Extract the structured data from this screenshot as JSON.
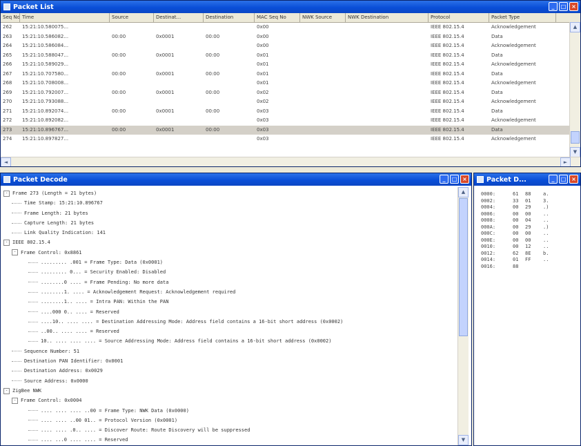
{
  "packet_list": {
    "title": "Packet List",
    "columns": [
      "Seq No",
      "Time",
      "Source",
      "Destinat...",
      "Destination",
      "MAC Seq No",
      "NWK Source",
      "NWK Destination",
      "Protocol",
      "Packet Type"
    ],
    "rows": [
      [
        "262",
        "15:21:10.580075...",
        "",
        "",
        "",
        "0x00",
        "",
        "",
        "IEEE 802.15.4",
        "Acknowledgement"
      ],
      [
        "263",
        "15:21:10.586082...",
        "00:00",
        "0x0001",
        "00:00",
        "0x00",
        "",
        "",
        "IEEE 802.15.4",
        "Data"
      ],
      [
        "264",
        "15:21:10.586084...",
        "",
        "",
        "",
        "0x00",
        "",
        "",
        "IEEE 802.15.4",
        "Acknowledgement"
      ],
      [
        "265",
        "15:21:10.588047...",
        "00:00",
        "0x0001",
        "00:00",
        "0x01",
        "",
        "",
        "IEEE 802.15.4",
        "Data"
      ],
      [
        "266",
        "15:21:10.589029...",
        "",
        "",
        "",
        "0x01",
        "",
        "",
        "IEEE 802.15.4",
        "Acknowledgement"
      ],
      [
        "267",
        "15:21:10.707580...",
        "00:00",
        "0x0001",
        "00:00",
        "0x01",
        "",
        "",
        "IEEE 802.15.4",
        "Data"
      ],
      [
        "268",
        "15:21:10.708008...",
        "",
        "",
        "",
        "0x01",
        "",
        "",
        "IEEE 802.15.4",
        "Acknowledgement"
      ],
      [
        "269",
        "15:21:10.792007...",
        "00:00",
        "0x0001",
        "00:00",
        "0x02",
        "",
        "",
        "IEEE 802.15.4",
        "Data"
      ],
      [
        "270",
        "15:21:10.793088...",
        "",
        "",
        "",
        "0x02",
        "",
        "",
        "IEEE 802.15.4",
        "Acknowledgement"
      ],
      [
        "271",
        "15:21:10.892074...",
        "00:00",
        "0x0001",
        "00:00",
        "0x03",
        "",
        "",
        "IEEE 802.15.4",
        "Data"
      ],
      [
        "272",
        "15:21:10.892082...",
        "",
        "",
        "",
        "0x03",
        "",
        "",
        "IEEE 802.15.4",
        "Acknowledgement"
      ],
      [
        "273",
        "15:21:10.896767...",
        "00:00",
        "0x0001",
        "00:00",
        "0x03",
        "",
        "",
        "IEEE 802.15.4",
        "Data"
      ],
      [
        "274",
        "15:21:10.897827...",
        "",
        "",
        "",
        "0x03",
        "",
        "",
        "IEEE 802.15.4",
        "Acknowledgement"
      ]
    ],
    "selected_row": 11
  },
  "packet_decode": {
    "title": "Packet Decode",
    "lines": [
      {
        "toggle": "-",
        "text": "Frame 273 (Length = 21 bytes)"
      },
      {
        "toggle": "",
        "text": "Time Stamp: 15:21:10.896767"
      },
      {
        "toggle": "",
        "text": "Frame Length: 21 bytes"
      },
      {
        "toggle": "",
        "text": "Capture Length: 21 bytes"
      },
      {
        "toggle": "",
        "text": "Link Quality Indication: 141"
      },
      {
        "toggle": "-",
        "text": "IEEE 802.15.4"
      },
      {
        "toggle": "-",
        "text": "Frame Control: 0x8861"
      },
      {
        "toggle": "",
        "text": "......... .001 = Frame Type: Data (0x0001)"
      },
      {
        "toggle": "",
        "text": "......... 0... = Security Enabled: Disabled"
      },
      {
        "toggle": "",
        "text": "........0 .... = Frame Pending: No more data"
      },
      {
        "toggle": "",
        "text": "........1. .... = Acknowledgement Request: Acknowledgement required"
      },
      {
        "toggle": "",
        "text": "........1.. .... = Intra PAN: Within the PAN"
      },
      {
        "toggle": "",
        "text": "....000 0.. .... = Reserved"
      },
      {
        "toggle": "",
        "text": "....10.. .... .... = Destination Addressing Mode: Address field contains a 16-bit short address (0x0002)"
      },
      {
        "toggle": "",
        "text": "..00.. .... .... = Reserved"
      },
      {
        "toggle": "",
        "text": "10.. .... .... .... = Source Addressing Mode: Address field contains a 16-bit short address (0x0002)"
      },
      {
        "toggle": "",
        "text": "Sequence Number: 51"
      },
      {
        "toggle": "",
        "text": "Destination PAN Identifier: 0x0001"
      },
      {
        "toggle": "",
        "text": "Destination Address: 0x0029"
      },
      {
        "toggle": "",
        "text": "Source Address: 0x0000"
      },
      {
        "toggle": "-",
        "text": "ZigBee NWK"
      },
      {
        "toggle": "-",
        "text": "Frame Control: 0x0004"
      },
      {
        "toggle": "",
        "text": ".... .... .... ..00 = Frame Type: NWK Data (0x0000)"
      },
      {
        "toggle": "",
        "text": ".... .... ..00 01.. = Protocol Version (0x0001)"
      },
      {
        "toggle": "",
        "text": ".... .... .0.. .... = Discover Route: Route Discovery will be suppressed"
      },
      {
        "toggle": "",
        "text": ".... ...0 .... .... = Reserved"
      }
    ]
  },
  "packet_data": {
    "title": "Packet D...",
    "rows": [
      [
        "0000:",
        "61",
        "88",
        "a."
      ],
      [
        "0002:",
        "33",
        "01",
        "3."
      ],
      [
        "0004:",
        "00",
        "29",
        ".)"
      ],
      [
        "0006:",
        "00",
        "00",
        ".."
      ],
      [
        "0008:",
        "00",
        "04",
        ".."
      ],
      [
        "000A:",
        "00",
        "29",
        ".)"
      ],
      [
        "000C:",
        "00",
        "00",
        ".."
      ],
      [
        "000E:",
        "00",
        "00",
        ".."
      ],
      [
        "0010:",
        "00",
        "12",
        ".."
      ],
      [
        "0012:",
        "62",
        "8E",
        "b."
      ],
      [
        "0014:",
        "01",
        "FF",
        ".."
      ],
      [
        "0016:",
        "88",
        "",
        ""
      ]
    ]
  }
}
